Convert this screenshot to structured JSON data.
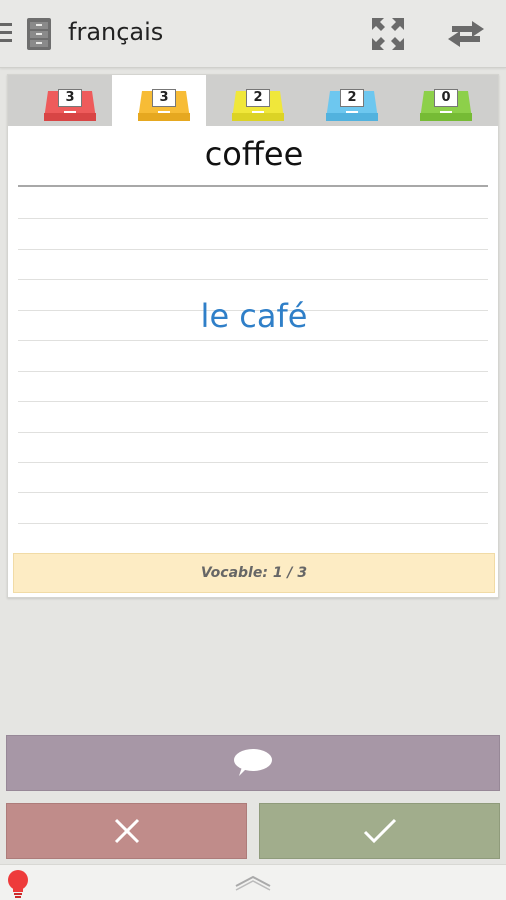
{
  "app": {
    "title": "français"
  },
  "colors": {
    "box_colors": [
      "#ee5b5b",
      "#f7bc36",
      "#f0e73a",
      "#6dc7ef",
      "#8dd04a"
    ],
    "answer": "#2f7fc8",
    "reveal_button": "#a797a6",
    "wrong_button": "#c08c8a",
    "right_button": "#a1ad8c"
  },
  "boxes": [
    {
      "count": "3",
      "color": "red",
      "active": false
    },
    {
      "count": "3",
      "color": "orange",
      "active": true
    },
    {
      "count": "2",
      "color": "yellow",
      "active": false
    },
    {
      "count": "2",
      "color": "blue",
      "active": false
    },
    {
      "count": "0",
      "color": "green",
      "active": false
    }
  ],
  "card": {
    "question": "coffee",
    "answer": "le café",
    "counter": "Vocable: 1 / 3"
  },
  "icons": {
    "menu": "hamburger-icon",
    "cabinet": "file-cabinet-icon",
    "expand": "expand-arrows-icon",
    "swap": "swap-arrows-icon",
    "reveal": "speech-bubble-icon",
    "wrong": "x-icon",
    "right": "checkmark-icon",
    "hint": "lightbulb-icon",
    "more": "chevron-up-icon"
  }
}
